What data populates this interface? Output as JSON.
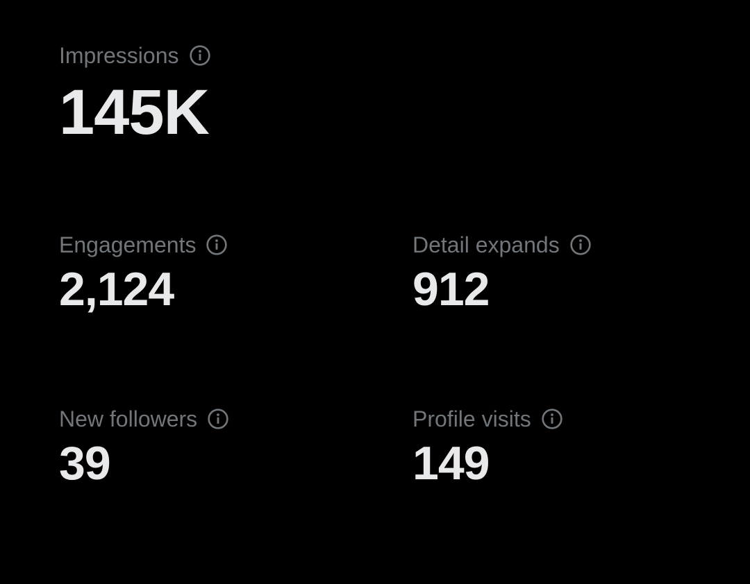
{
  "metrics": {
    "impressions": {
      "label": "Impressions",
      "value": "145K"
    },
    "engagements": {
      "label": "Engagements",
      "value": "2,124"
    },
    "detail_expands": {
      "label": "Detail expands",
      "value": "912"
    },
    "new_followers": {
      "label": "New followers",
      "value": "39"
    },
    "profile_visits": {
      "label": "Profile visits",
      "value": "149"
    }
  },
  "icons": {
    "info": "info-circle-icon"
  },
  "colors": {
    "background": "#000000",
    "label": "#71767b",
    "value": "#e7e9ea"
  }
}
